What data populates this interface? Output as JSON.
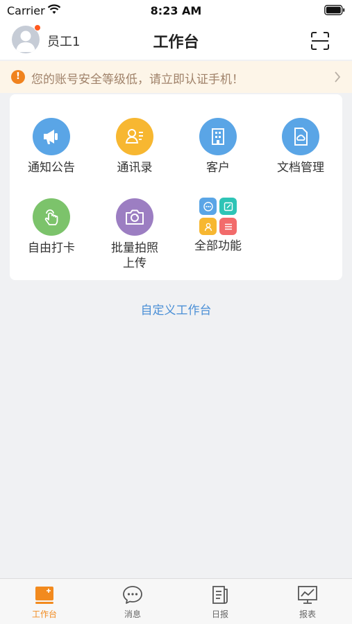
{
  "status_bar": {
    "carrier": "Carrier",
    "time": "8:23 AM"
  },
  "header": {
    "user_name": "员工1",
    "title": "工作台"
  },
  "notice": {
    "text": "您的账号安全等级低，请立即认证手机！",
    "icon": "exclamation-icon"
  },
  "grid": {
    "items": [
      {
        "label": "通知公告",
        "icon": "megaphone-icon",
        "color": "#5aa5e6"
      },
      {
        "label": "通讯录",
        "icon": "contact-card-icon",
        "color": "#f7b731"
      },
      {
        "label": "客户",
        "icon": "building-icon",
        "color": "#5aa5e6"
      },
      {
        "label": "文档管理",
        "icon": "cloud-document-icon",
        "color": "#5aa5e6"
      },
      {
        "label": "自由打卡",
        "icon": "tap-hand-icon",
        "color": "#7cc36b"
      },
      {
        "label": "批量拍照\n上传",
        "icon": "camera-icon",
        "color": "#9c7ec2"
      },
      {
        "label": "全部功能",
        "icon": "all-apps-icon",
        "color": "#5aa5e6"
      }
    ]
  },
  "customize_link": "自定义工作台",
  "tabs": [
    {
      "label": "工作台",
      "icon": "workbench-icon",
      "active": true
    },
    {
      "label": "消息",
      "icon": "chat-bubble-icon",
      "active": false
    },
    {
      "label": "日报",
      "icon": "daily-report-icon",
      "active": false
    },
    {
      "label": "报表",
      "icon": "chart-report-icon",
      "active": false
    }
  ],
  "colors": {
    "accent": "#f28a1e",
    "link": "#4a8fd6",
    "notice_bg": "#fdf5e8",
    "notice_text": "#a0826a"
  }
}
